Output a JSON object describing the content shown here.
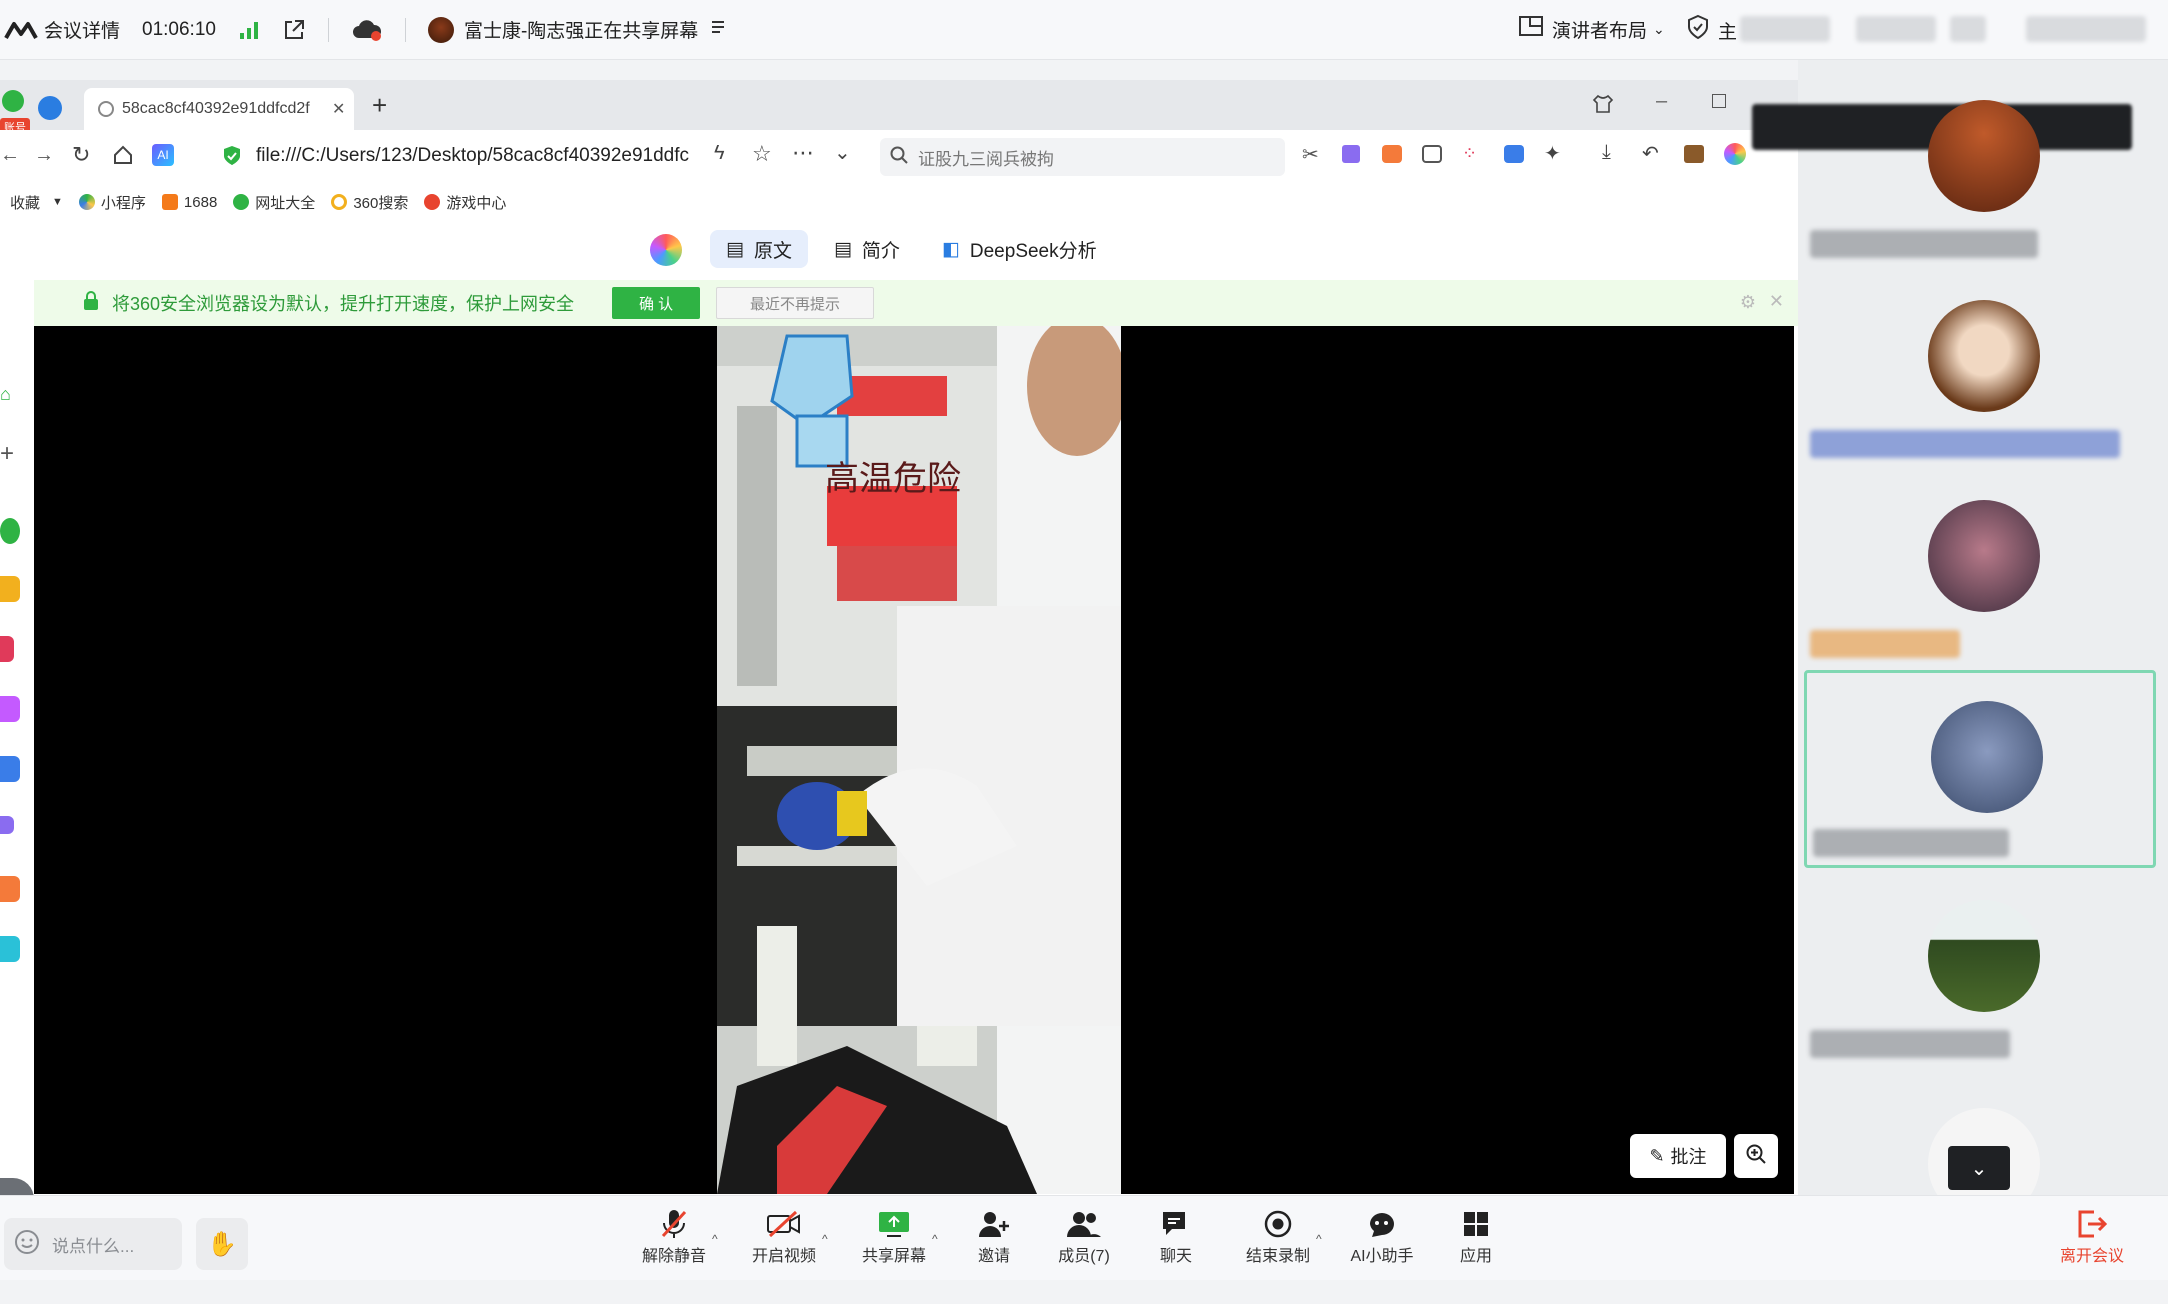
{
  "topbar": {
    "meeting_details": "会议详情",
    "timer": "01:06:10",
    "sharer_text": "富士康-陶志强正在共享屏幕",
    "layout_label": "演讲者布局",
    "host_label": "主"
  },
  "browser": {
    "tab_title": "58cac8cf40392e91ddfcd2f",
    "badge": "账号",
    "url": "file:///C:/Users/123/Desktop/58cac8cf40392e91ddfc",
    "search_placeholder": "证股九三阅兵被拘",
    "bookmarks": [
      "收藏",
      "小程序",
      "1688",
      "网址大全",
      "360搜索",
      "游戏中心"
    ],
    "reader_tabs": [
      "原文",
      "简介",
      "DeepSeek分析"
    ],
    "notice": {
      "text": "将360安全浏览器设为默认，提升打开速度，保护上网安全",
      "confirm": "确 认",
      "dismiss": "最近不再提示"
    }
  },
  "video": {
    "sign_text": "高温危险"
  },
  "annotate_label": "批注",
  "bottombar": {
    "chat_placeholder": "说点什么...",
    "tools": [
      {
        "label": "解除静音",
        "icon": "mic-muted-icon"
      },
      {
        "label": "开启视频",
        "icon": "camera-off-icon"
      },
      {
        "label": "共享屏幕",
        "icon": "share-screen-icon"
      },
      {
        "label": "邀请",
        "icon": "invite-icon"
      },
      {
        "label": "成员(7)",
        "icon": "members-icon"
      },
      {
        "label": "聊天",
        "icon": "chat-icon"
      },
      {
        "label": "结束录制",
        "icon": "record-stop-icon"
      },
      {
        "label": "AI小助手",
        "icon": "ai-assistant-icon"
      },
      {
        "label": "应用",
        "icon": "apps-icon"
      }
    ],
    "leave_label": "离开会议"
  },
  "colors": {
    "accent_green": "#2fb344",
    "leave_red": "#e8442f",
    "active_frame": "#7fd7b2"
  }
}
